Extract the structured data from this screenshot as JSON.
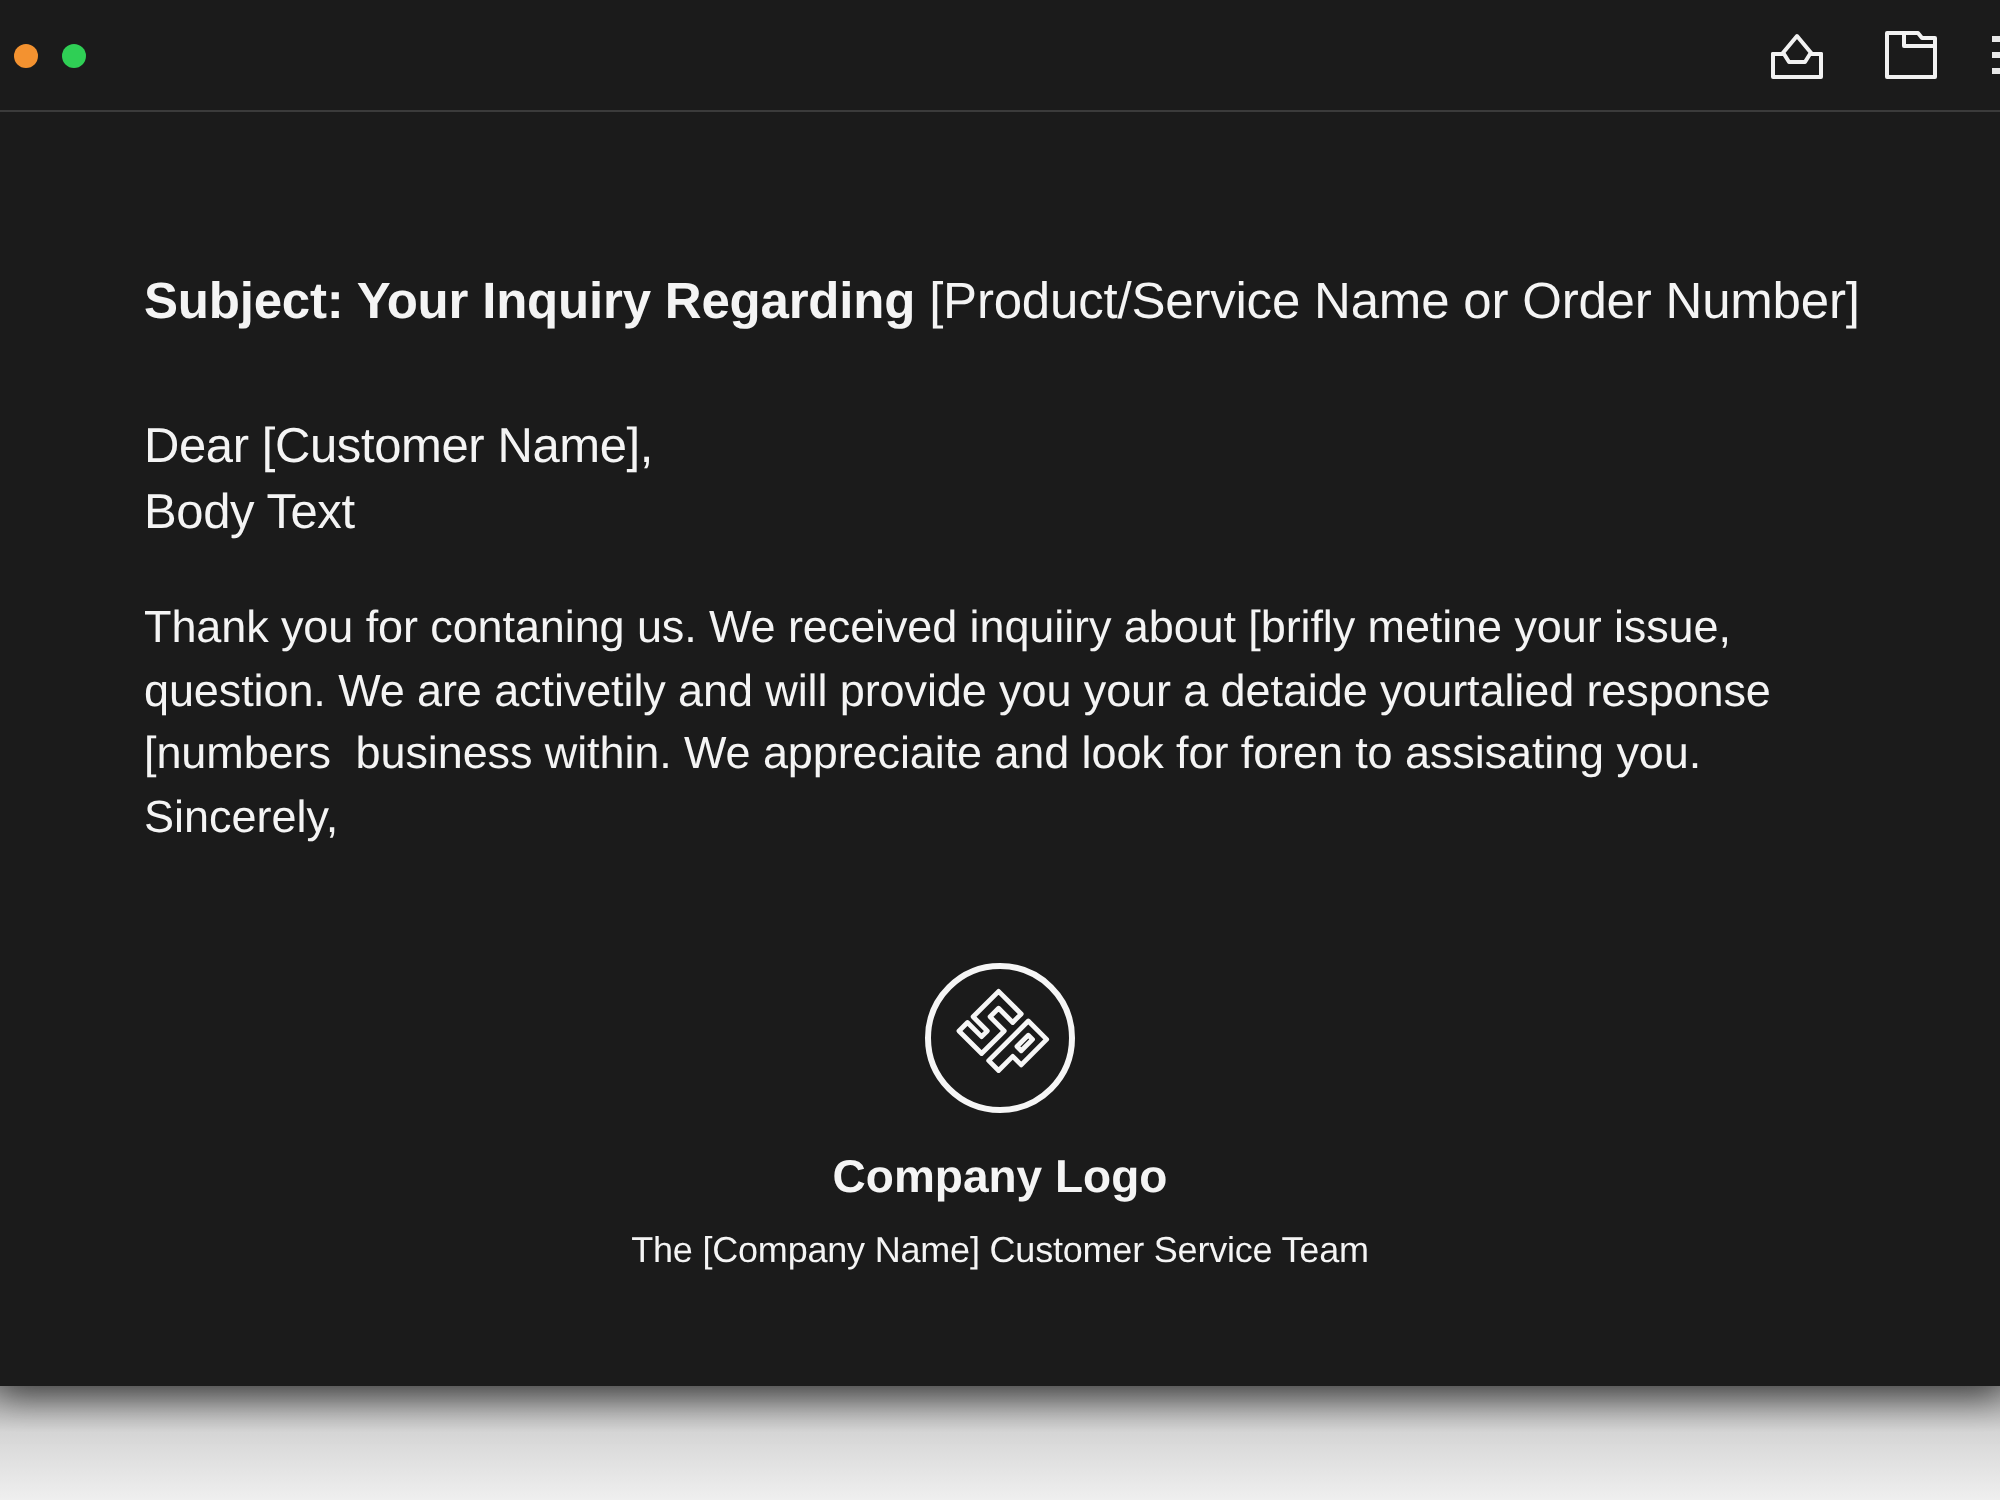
{
  "window": {
    "controls": [
      {
        "color": "#f39230"
      },
      {
        "color": "#2fcf55"
      }
    ]
  },
  "email": {
    "subject": "**Subject: Your Inquiry Regarding** [Product/Service Name or Order Number]",
    "greeting": "Dear [Customer Name],",
    "section_label": "Body Text",
    "body_lines": [
      "Thank you for contaning us. We received inquiiry about [brifly metine your issue,",
      "question. We are activetily and will provide you your a detaide yourtalied response",
      "[numbers  business within. We appreciaite and look for foren to assisating you."
    ],
    "closing": "Sincerely,"
  },
  "signature": {
    "logo_label": "Company Logo",
    "team": "The [Company Name] Customer Service Team"
  }
}
